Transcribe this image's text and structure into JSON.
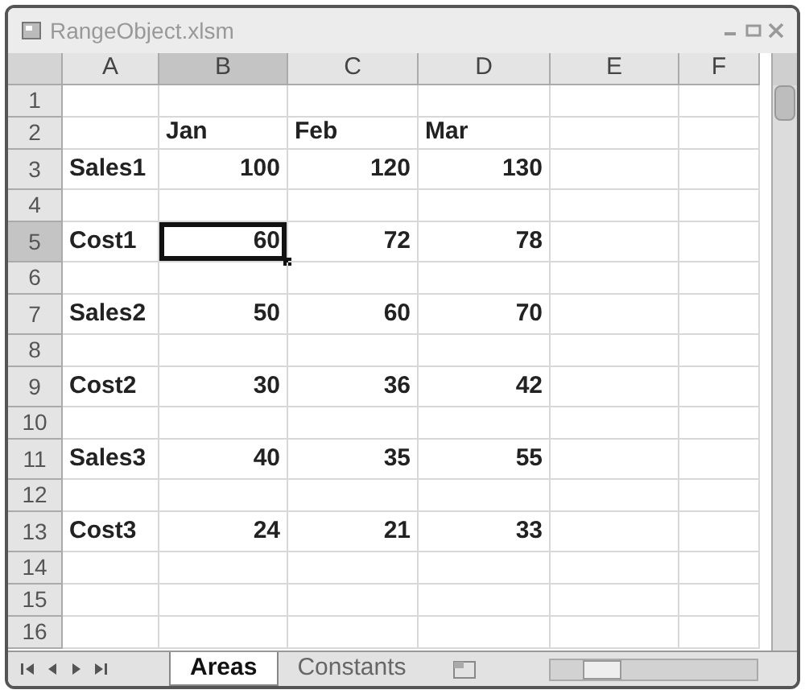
{
  "window": {
    "title": "RangeObject.xlsm"
  },
  "columns": [
    {
      "label": "A",
      "selected": false
    },
    {
      "label": "B",
      "selected": true
    },
    {
      "label": "C",
      "selected": false
    },
    {
      "label": "D",
      "selected": false
    },
    {
      "label": "E",
      "selected": false
    },
    {
      "label": "F",
      "selected": false
    }
  ],
  "rows": [
    {
      "number": "1",
      "kind": "empty",
      "selected": false
    },
    {
      "number": "2",
      "kind": "heading",
      "selected": false,
      "values": [
        "Jan",
        "Feb",
        "Mar"
      ]
    },
    {
      "number": "3",
      "kind": "data",
      "selected": false,
      "label": "Sales1",
      "values": [
        "100",
        "120",
        "130"
      ]
    },
    {
      "number": "4",
      "kind": "empty",
      "selected": false
    },
    {
      "number": "5",
      "kind": "data",
      "selected": true,
      "label": "Cost1",
      "values": [
        "60",
        "72",
        "78"
      ]
    },
    {
      "number": "6",
      "kind": "empty",
      "selected": false
    },
    {
      "number": "7",
      "kind": "data",
      "selected": false,
      "label": "Sales2",
      "values": [
        "50",
        "60",
        "70"
      ]
    },
    {
      "number": "8",
      "kind": "empty",
      "selected": false
    },
    {
      "number": "9",
      "kind": "data",
      "selected": false,
      "label": "Cost2",
      "values": [
        "30",
        "36",
        "42"
      ]
    },
    {
      "number": "10",
      "kind": "empty",
      "selected": false
    },
    {
      "number": "11",
      "kind": "data",
      "selected": false,
      "label": "Sales3",
      "values": [
        "40",
        "35",
        "55"
      ]
    },
    {
      "number": "12",
      "kind": "empty",
      "selected": false
    },
    {
      "number": "13",
      "kind": "data",
      "selected": false,
      "label": "Cost3",
      "values": [
        "24",
        "21",
        "33"
      ]
    },
    {
      "number": "14",
      "kind": "empty",
      "selected": false
    },
    {
      "number": "15",
      "kind": "empty",
      "selected": false
    },
    {
      "number": "16",
      "kind": "empty",
      "selected": false
    }
  ],
  "sheet_tabs": [
    {
      "label": "Areas",
      "selected": true
    },
    {
      "label": "Constants",
      "selected": false
    }
  ]
}
